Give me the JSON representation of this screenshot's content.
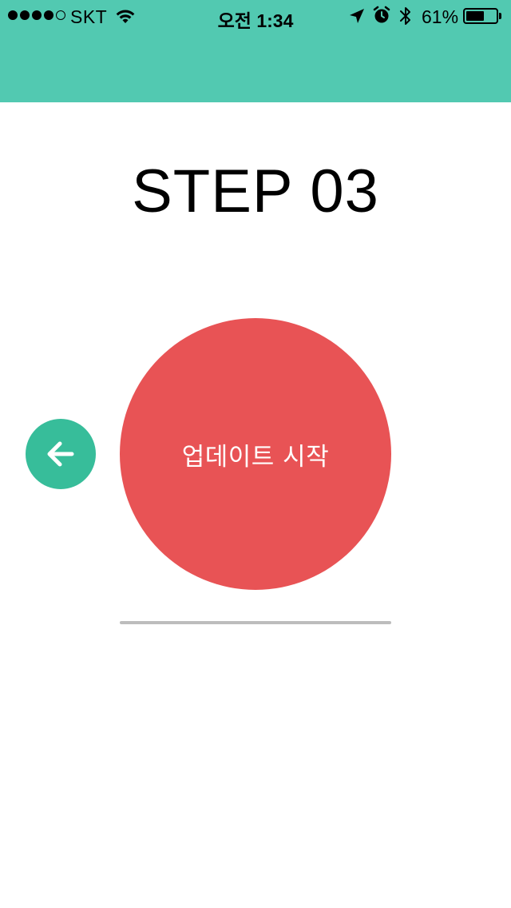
{
  "status_bar": {
    "signal_bars_filled": 4,
    "signal_bars_total": 5,
    "carrier": "SKT",
    "time": "오전 1:34",
    "battery_percent_label": "61%",
    "battery_level": 0.61,
    "icons": [
      "signal-dots-icon",
      "wifi-icon",
      "location-arrow-icon",
      "alarm-clock-icon",
      "bluetooth-icon",
      "battery-icon"
    ]
  },
  "colors": {
    "header": "#52c9b1",
    "back_button": "#37bd9a",
    "start_button": "#e85355",
    "progress_track": "#bdbdbd"
  },
  "page": {
    "title": "STEP 03",
    "start_button_label": "업데이트 시작",
    "back_icon": "arrow-left-icon",
    "progress": 0
  }
}
